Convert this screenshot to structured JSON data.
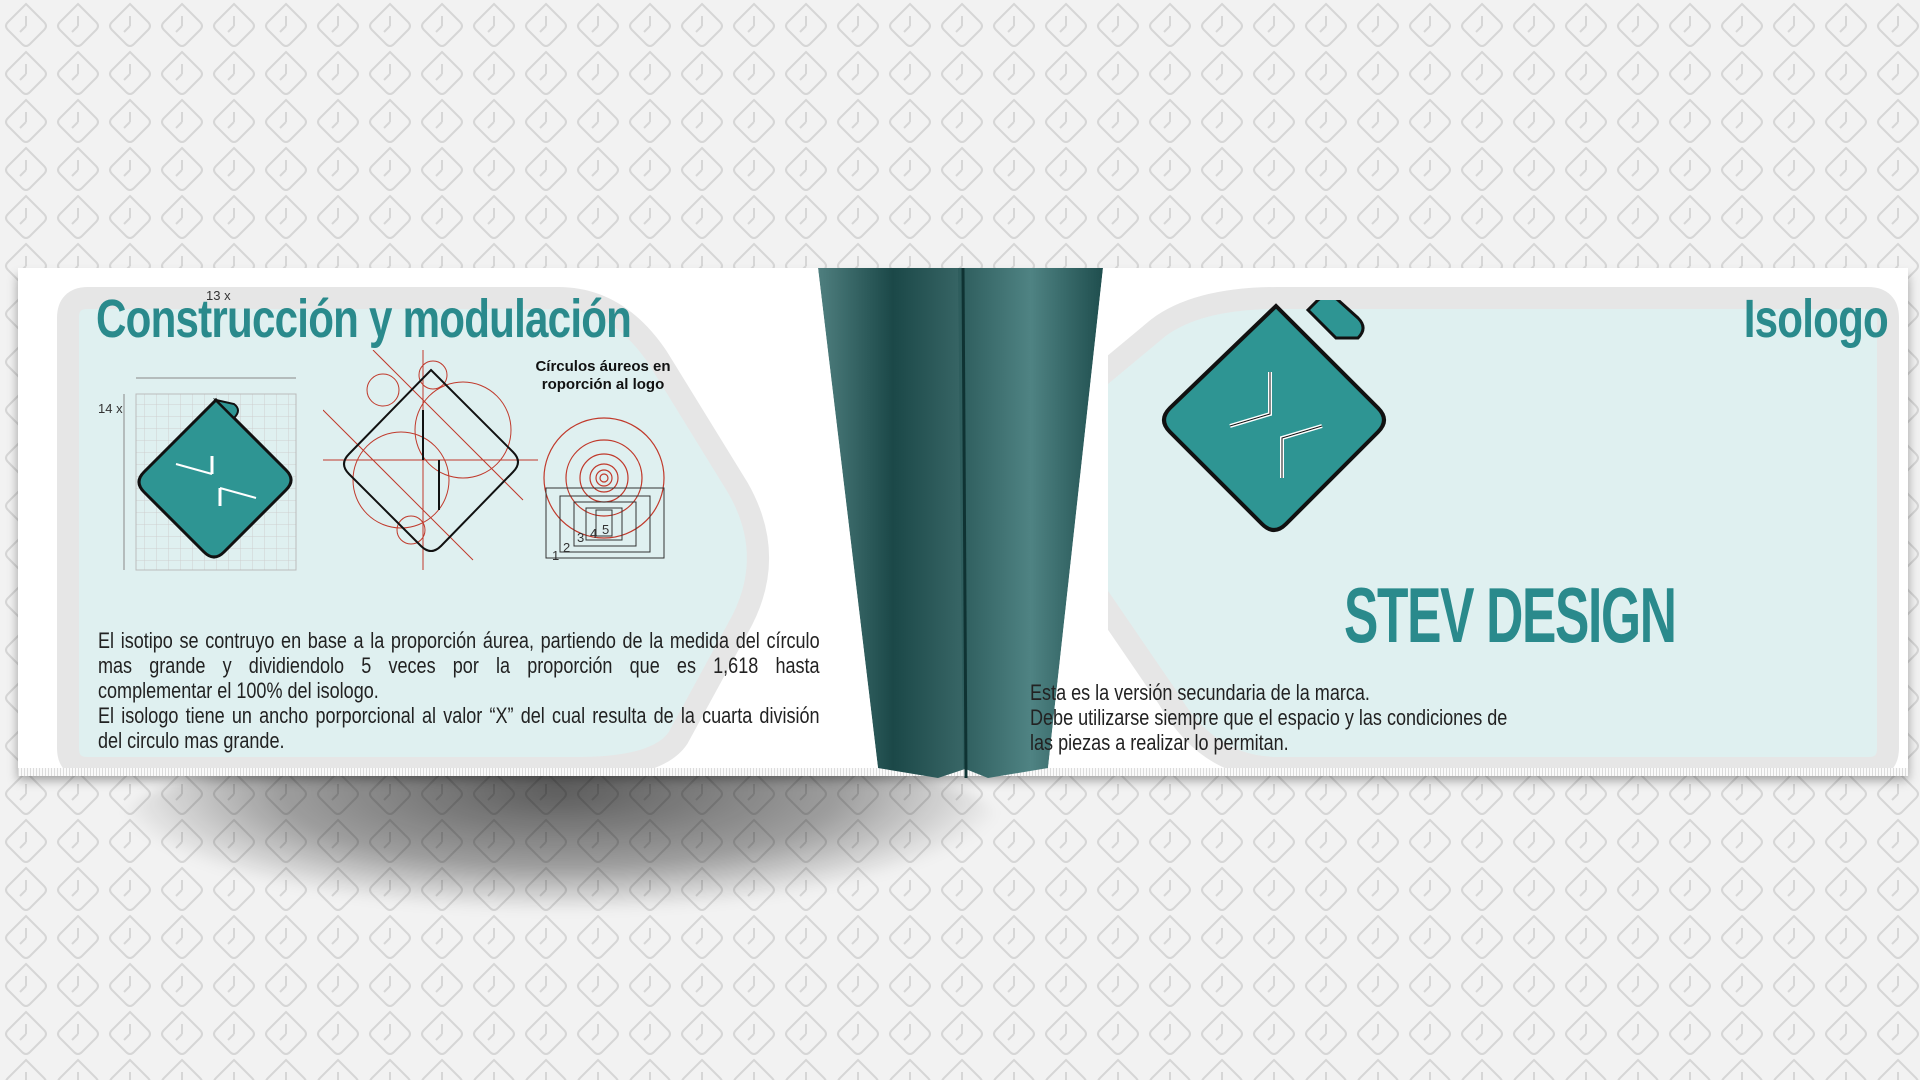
{
  "left_page": {
    "title": "Construcción y modulación",
    "grid": {
      "width_label": "13 x",
      "height_label": "14 x"
    },
    "circles_caption": [
      "Círculos áureos en",
      "roporción al logo"
    ],
    "circle_numbers": [
      "1",
      "2",
      "3",
      "4",
      "5"
    ],
    "paragraph": [
      "El isotipo se contruyo en base a la proporción áurea, partiendo de la medida del círculo",
      "mas grande y dividiendolo 5 veces por la proporción que es 1,618 hasta",
      "complementar el 100% del isologo.",
      "El isologo tiene un ancho porporcional al valor “X” del cual resulta de la cuarta división",
      "del circulo mas grande."
    ]
  },
  "right_page": {
    "title": "Isologo",
    "brand_name": "STEV DESIGN",
    "paragraph": [
      "Esta es la versión secundaria de la marca.",
      "Debe utilizarse siempre que el espacio y las condiciones de",
      "las piezas a realizar lo permitan."
    ]
  },
  "colors": {
    "teal": "#2a8a8c",
    "logo_fill": "#2e9593",
    "light_teal": "#dff0f0",
    "gutter_dark": "#1e4a4a"
  },
  "icons": [
    "stev-logo-icon",
    "construction-grid",
    "golden-circles"
  ]
}
